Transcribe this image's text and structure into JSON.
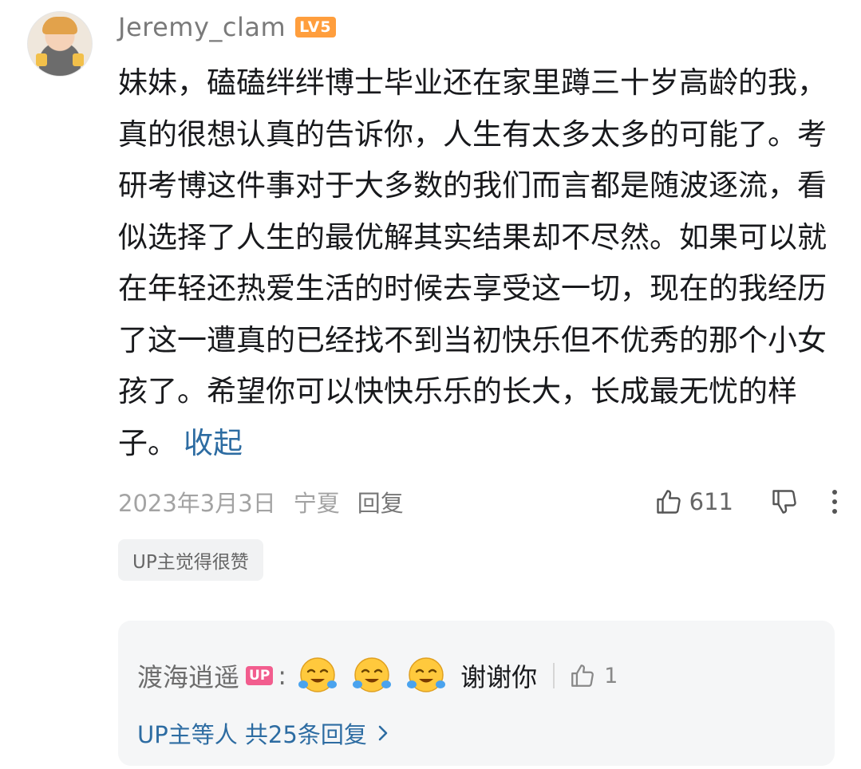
{
  "comment": {
    "username": "Jeremy_clam",
    "level_badge": "LV5",
    "body": "妹妹，磕磕绊绊博士毕业还在家里蹲三十岁高龄的我，真的很想认真的告诉你，人生有太多太多的可能了。考研考博这件事对于大多数的我们而言都是随波逐流，看似选择了人生的最优解其实结果却不尽然。如果可以就在年轻还热爱生活的时候去享受这一切，现在的我经历了这一遭真的已经找不到当初快乐但不优秀的那个小女孩了。希望你可以快快乐乐的长大，长成最无忧的样子。",
    "collapse_label": "收起",
    "date": "2023年3月3日",
    "location": "宁夏",
    "reply_label": "回复",
    "like_count": "611",
    "up_tag": "UP主觉得很赞"
  },
  "reply": {
    "username": "渡海逍遥",
    "up_badge": "UP",
    "colon": ":",
    "text": "谢谢你",
    "like_count": "1",
    "more_replies": "UP主等人 共25条回复"
  },
  "icons": {
    "like": "thumbs-up-icon",
    "dislike": "thumbs-down-icon",
    "more": "more-vertical-icon",
    "emoji": "crying-laugh-emoji",
    "chevron": "chevron-right-icon"
  },
  "colors": {
    "link": "#2d6ca2",
    "level_badge": "#ff9e3d",
    "up_badge": "#f25d8e",
    "reply_bg": "#f5f6f7"
  }
}
